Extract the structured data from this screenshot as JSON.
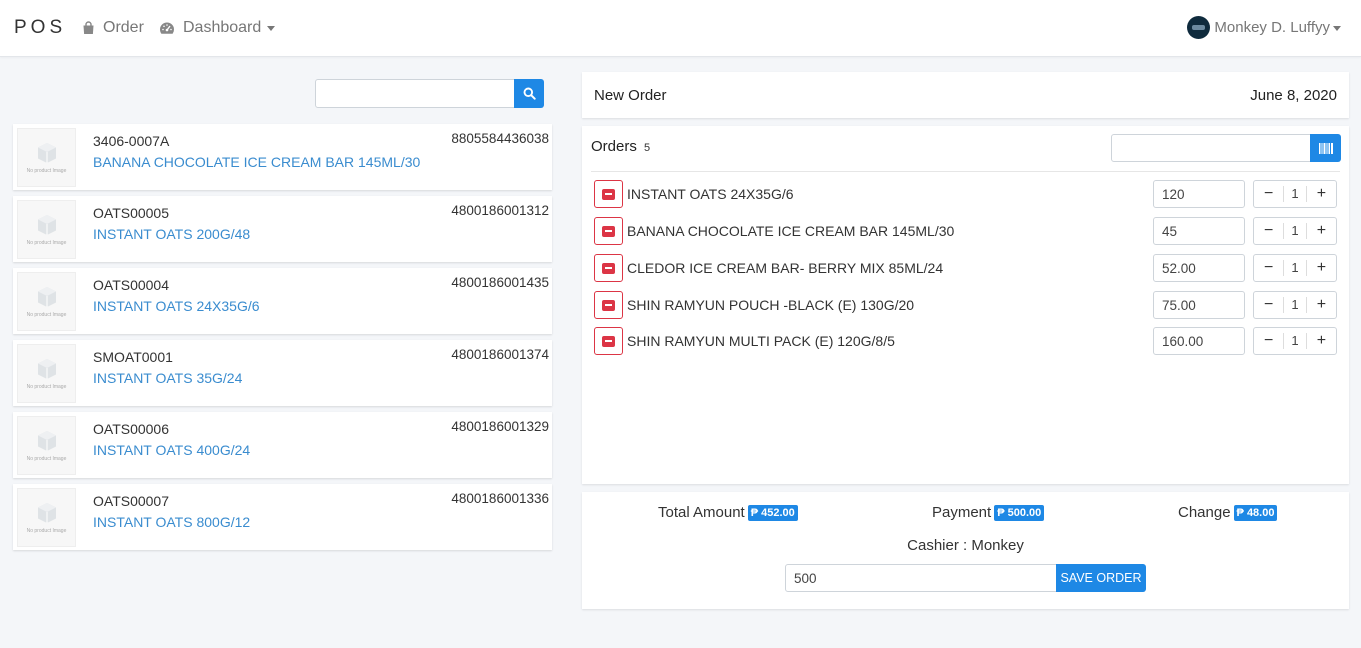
{
  "navbar": {
    "brand": "POS",
    "order_label": "Order",
    "dashboard_label": "Dashboard",
    "user_name": "Monkey D. Luffyy"
  },
  "product_search": {
    "value": "",
    "placeholder": ""
  },
  "products": [
    {
      "code": "3406-0007A",
      "name": "BANANA CHOCOLATE ICE CREAM BAR 145ML/30",
      "barcode": "8805584436038",
      "image_text": "No product Image"
    },
    {
      "code": "OATS00005",
      "name": "INSTANT OATS 200G/48",
      "barcode": "4800186001312",
      "image_text": "No product Image"
    },
    {
      "code": "OATS00004",
      "name": "INSTANT OATS 24X35G/6",
      "barcode": "4800186001435",
      "image_text": "No product Image"
    },
    {
      "code": "SMOAT0001",
      "name": "INSTANT OATS 35G/24",
      "barcode": "4800186001374",
      "image_text": "No product Image"
    },
    {
      "code": "OATS00006",
      "name": "INSTANT OATS 400G/24",
      "barcode": "4800186001329",
      "image_text": "No product Image"
    },
    {
      "code": "OATS00007",
      "name": "INSTANT OATS 800G/12",
      "barcode": "4800186001336",
      "image_text": "No product Image"
    }
  ],
  "order_header": {
    "title": "New Order",
    "date": "June 8, 2020"
  },
  "orders": {
    "label": "Orders",
    "count": "5",
    "barcode_value": "",
    "items": [
      {
        "name": "INSTANT OATS 24X35G/6",
        "price": "120",
        "qty": "1"
      },
      {
        "name": "BANANA CHOCOLATE ICE CREAM BAR 145ML/30",
        "price": "45",
        "qty": "1"
      },
      {
        "name": "CLEDOR ICE CREAM BAR- BERRY MIX 85ML/24",
        "price": "52.00",
        "qty": "1"
      },
      {
        "name": "SHIN RAMYUN POUCH -BLACK (E) 130G/20",
        "price": "75.00",
        "qty": "1"
      },
      {
        "name": "SHIN RAMYUN MULTI PACK (E) 120G/8/5",
        "price": "160.00",
        "qty": "1"
      }
    ],
    "minus_symbol": "−",
    "plus_symbol": "+"
  },
  "summary": {
    "total_label": "Total Amount",
    "total_value": "₱ 452.00",
    "payment_label": "Payment",
    "payment_value": "₱ 500.00",
    "change_label": "Change",
    "change_value": "₱ 48.00",
    "cashier": "Cashier : Monkey",
    "payment_input": "500",
    "save_label": "SAVE ORDER"
  },
  "colors": {
    "accent": "#1e88e5",
    "danger": "#dc3545",
    "link": "#3a8ccf"
  },
  "icons": {
    "order": "shopping-bag-icon",
    "dashboard": "tachometer-icon",
    "search": "search-icon",
    "barcode": "barcode-icon",
    "remove": "minus-square-icon",
    "product_image": "cube-icon"
  }
}
